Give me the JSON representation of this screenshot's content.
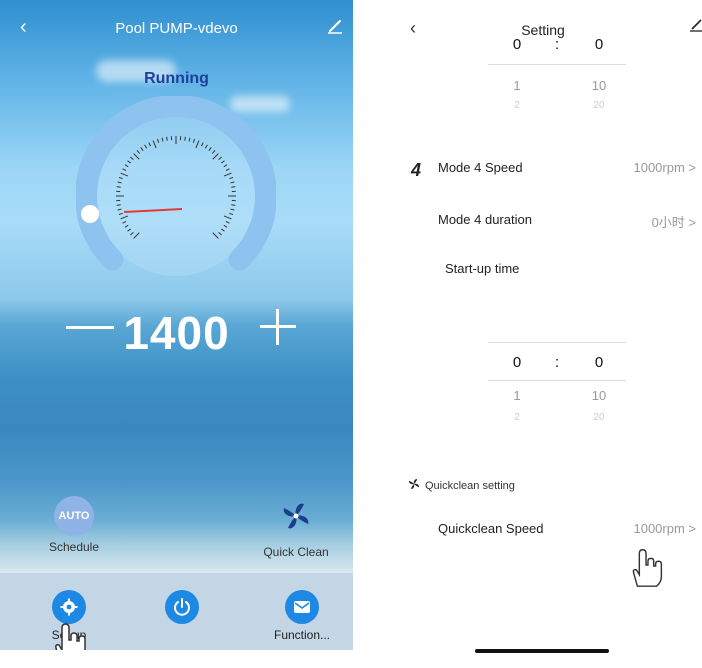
{
  "left": {
    "title": "Pool PUMP-vdevo",
    "back_icon": "‹",
    "status": "Running",
    "speed_value": "1400",
    "gauge_level": 0.0,
    "shortcuts": {
      "schedule_label": "Schedule",
      "schedule_icon_text": "AUTO",
      "quick_clean_label": "Quick Clean"
    },
    "bottom_nav": {
      "setup_label": "Set up",
      "function_label": "Function..."
    }
  },
  "right": {
    "title": "Setting",
    "back_icon": "‹",
    "picker_top": {
      "r0": [
        "0",
        ":",
        "0"
      ],
      "r1": [
        "1",
        "10"
      ],
      "r2": [
        "2",
        "20"
      ]
    },
    "mode_number": "4",
    "mode_speed_label": "Mode 4 Speed",
    "mode_speed_value": "1000rpm  >",
    "mode_duration_label": "Mode 4 duration",
    "mode_duration_value": "0小时  >",
    "startup_label": "Start-up time",
    "picker_bottom": {
      "r0": [
        "0",
        ":",
        "0"
      ],
      "r1": [
        "1",
        "10"
      ],
      "r2": [
        "2",
        "20"
      ]
    },
    "quickclean_heading": "Quickclean setting",
    "quickclean_speed_label": "Quickclean Speed",
    "quickclean_speed_value": "1000rpm  >"
  },
  "colors": {
    "accent_blue": "#1e88e5",
    "status_text": "#1f3f9a",
    "needle": "#e53935",
    "gauge_arc": "#8ec3f0"
  }
}
